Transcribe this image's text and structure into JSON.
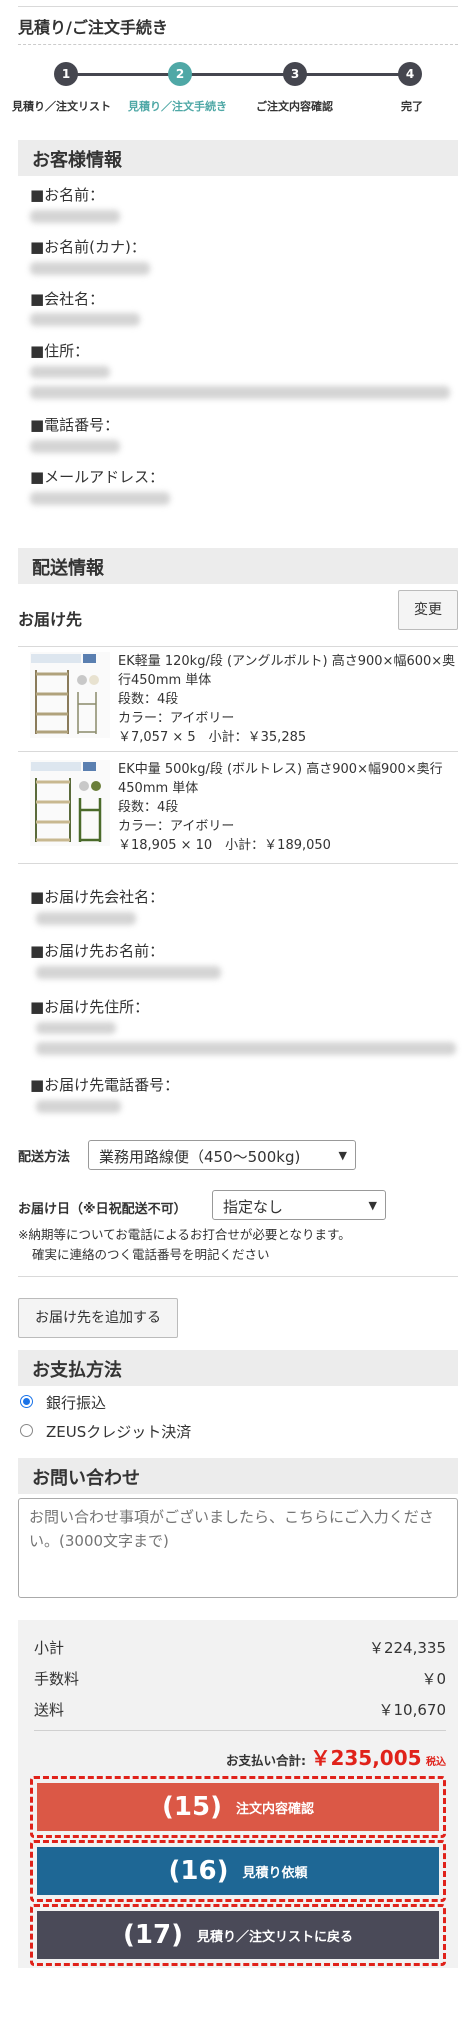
{
  "page_title": "見積り/ご注文手続き",
  "steps": [
    {
      "num": "1",
      "label": "見積り／注文リスト"
    },
    {
      "num": "2",
      "label": "見積り／注文手続き"
    },
    {
      "num": "3",
      "label": "ご注文内容確認"
    },
    {
      "num": "4",
      "label": "完了"
    }
  ],
  "customer": {
    "heading": "お客様情報",
    "name_label": "■お名前：",
    "kana_label": "■お名前(カナ)：",
    "company_label": "■会社名：",
    "address_label": "■住所：",
    "phone_label": "■電話番号：",
    "email_label": "■メールアドレス："
  },
  "shipping": {
    "heading": "配送情報",
    "dest_label": "お届け先",
    "change_button": "変更",
    "items": [
      {
        "name": "EK軽量 120kg/段 (アングルボルト) 高さ900×幅600×奥行450mm 単体",
        "tiers": "段数：4段",
        "color": "カラー：アイボリー",
        "price": "￥7,057 × 5　小計：￥35,285"
      },
      {
        "name": "EK中量 500kg/段 (ボルトレス) 高さ900×幅900×奥行450mm 単体",
        "tiers": "段数：4段",
        "color": "カラー：アイボリー",
        "price": "￥18,905 × 10　小計：￥189,050"
      }
    ],
    "dest_company_label": "■お届け先会社名：",
    "dest_name_label": "■お届け先お名前：",
    "dest_address_label": "■お届け先住所：",
    "dest_phone_label": "■お届け先電話番号：",
    "method_label": "配送方法",
    "method_value": "業務用路線便（450〜500kg)",
    "date_label": "お届け日（※日祝配送不可）",
    "date_value": "指定なし",
    "note1": "※納期等についてお電話によるお打合せが必要となります。",
    "note2": "確実に連絡のつく電話番号を明記ください",
    "add_dest_button": "お届け先を追加する"
  },
  "payment": {
    "heading": "お支払方法",
    "options": [
      "銀行振込",
      "ZEUSクレジット決済"
    ],
    "selected": "銀行振込"
  },
  "inquiry": {
    "heading": "お問い合わせ",
    "placeholder": "お問い合わせ事項がございましたら、こちらにご入力ください。(3000文字まで)"
  },
  "summary": {
    "subtotal_label": "小計",
    "subtotal_value": "￥224,335",
    "fee_label": "手数料",
    "fee_value": "￥0",
    "shipping_label": "送料",
    "shipping_value": "￥10,670",
    "total_label": "お支払い合計:",
    "total_value": "￥235,005",
    "tax_label": "税込"
  },
  "buttons": [
    {
      "num": "(15)",
      "label": "注文内容確認",
      "color": "#db5846"
    },
    {
      "num": "(16)",
      "label": "見積り依頼",
      "color": "#1e6795"
    },
    {
      "num": "(17)",
      "label": "見積り／注文リストに戻る",
      "color": "#4a4a58"
    }
  ],
  "colors": {
    "accent": "#4fa8a6",
    "step_dark": "#45464f",
    "price_red": "#e0221a"
  }
}
